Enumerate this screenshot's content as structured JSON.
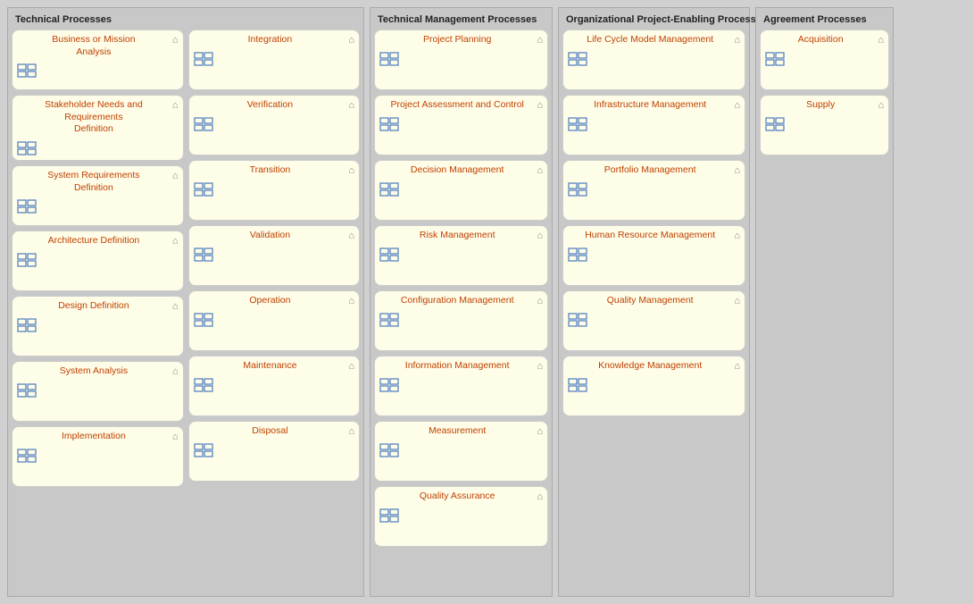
{
  "columns": [
    {
      "id": "technical",
      "header": "Technical Processes",
      "layout": "two-col",
      "leftCards": [
        {
          "title": "Business or Mission Analysis",
          "multiline": true
        },
        {
          "title": "Stakeholder Needs and Requirements Definition",
          "multiline": true
        },
        {
          "title": "System Requirements Definition",
          "multiline": true
        },
        {
          "title": "Architecture Definition",
          "multiline": false
        },
        {
          "title": "Design Definition",
          "multiline": false
        },
        {
          "title": "System Analysis",
          "multiline": false
        },
        {
          "title": "Implementation",
          "multiline": false
        }
      ],
      "rightCards": [
        {
          "title": "Integration",
          "multiline": false
        },
        {
          "title": "Verification",
          "multiline": false
        },
        {
          "title": "Transition",
          "multiline": false
        },
        {
          "title": "Validation",
          "multiline": false
        },
        {
          "title": "Operation",
          "multiline": false
        },
        {
          "title": "Maintenance",
          "multiline": false
        },
        {
          "title": "Disposal",
          "multiline": false
        }
      ]
    },
    {
      "id": "tech-management",
      "header": "Technical Management Processes",
      "layout": "single-col",
      "cards": [
        {
          "title": "Project Planning"
        },
        {
          "title": "Project Assessment and Control"
        },
        {
          "title": "Decision Management"
        },
        {
          "title": "Risk Management"
        },
        {
          "title": "Configuration Management"
        },
        {
          "title": "Information Management"
        },
        {
          "title": "Measurement"
        },
        {
          "title": "Quality Assurance"
        }
      ]
    },
    {
      "id": "org",
      "header": "Organizational Project-Enabling Processes",
      "layout": "single-col",
      "cards": [
        {
          "title": "Life Cycle Model Management"
        },
        {
          "title": "Infrastructure Management"
        },
        {
          "title": "Portfolio Management"
        },
        {
          "title": "Human Resource Management"
        },
        {
          "title": "Quality Management"
        },
        {
          "title": "Knowledge Management"
        }
      ]
    },
    {
      "id": "agreement",
      "header": "Agreement Processes",
      "layout": "single-col",
      "cards": [
        {
          "title": "Acquisition"
        },
        {
          "title": "Supply"
        }
      ]
    }
  ],
  "bookmark_char": "⌂",
  "icons": {
    "grid": "grid-icon"
  }
}
